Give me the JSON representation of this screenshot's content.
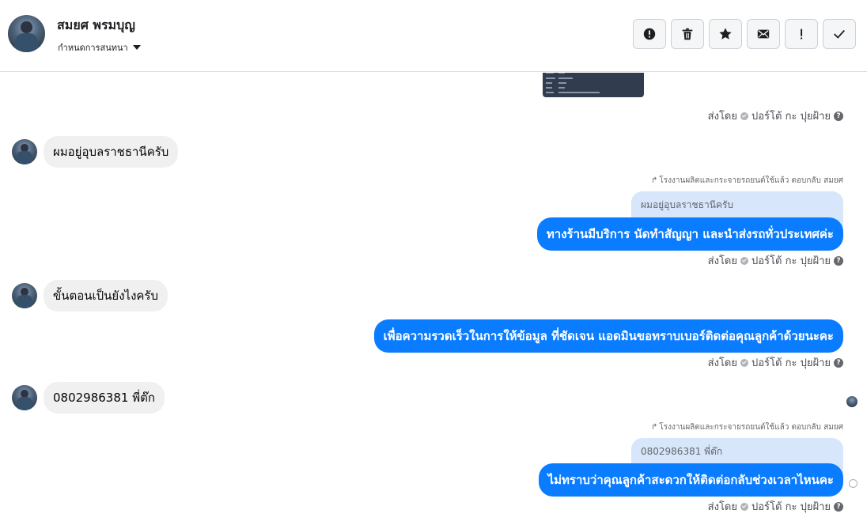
{
  "header": {
    "name": "สมยศ พรมบุญ",
    "assign_label": "กำหนดการสนทนา"
  },
  "toolbar": {
    "buttons": [
      {
        "icon": "alert-icon"
      },
      {
        "icon": "trash-icon"
      },
      {
        "icon": "star-icon"
      },
      {
        "icon": "mail-icon"
      },
      {
        "icon": "exclamation-icon"
      },
      {
        "icon": "check-icon"
      }
    ]
  },
  "sent_by": {
    "prefix": "ส่งโดย",
    "agent": "ปอร์โต้ กะ ปุยฝ้าย",
    "help": "?"
  },
  "reply": {
    "header": "โรงงานผลิตและกระจายรถยนต์ใช้แล้ว ตอบกลับ สมยศ"
  },
  "messages": {
    "m1_in": "ผมอยู่อุบลราชธานีครับ",
    "m1_quote": "ผมอยู่อุบลราชธานีครับ",
    "m1_out": "ทางร้านมีบริการ นัดทำสัญญา และนำส่งรถทั่วประเทศค่ะ",
    "m2_in": "ขั้นตอนเป็นยังไงครับ",
    "m2_out": "เพื่อความรวดเร็วในการให้ข้อมูล ที่ชัดเจน แอดมินขอทราบเบอร์ติดต่อคุณลูกค้าด้วยนะคะ",
    "m3_in": "0802986381 พี่ต๊ก",
    "m3_quote": "0802986381 พี่ต๊ก",
    "m3_out": "ไม่ทราบว่าคุณลูกค้าสะดวกให้ติดต่อกลับช่วงเวลาไหนคะ"
  },
  "colors": {
    "accent": "#0a7cff",
    "quote_bg": "#d7e6fb",
    "incoming_bg": "#f0f0f0"
  }
}
